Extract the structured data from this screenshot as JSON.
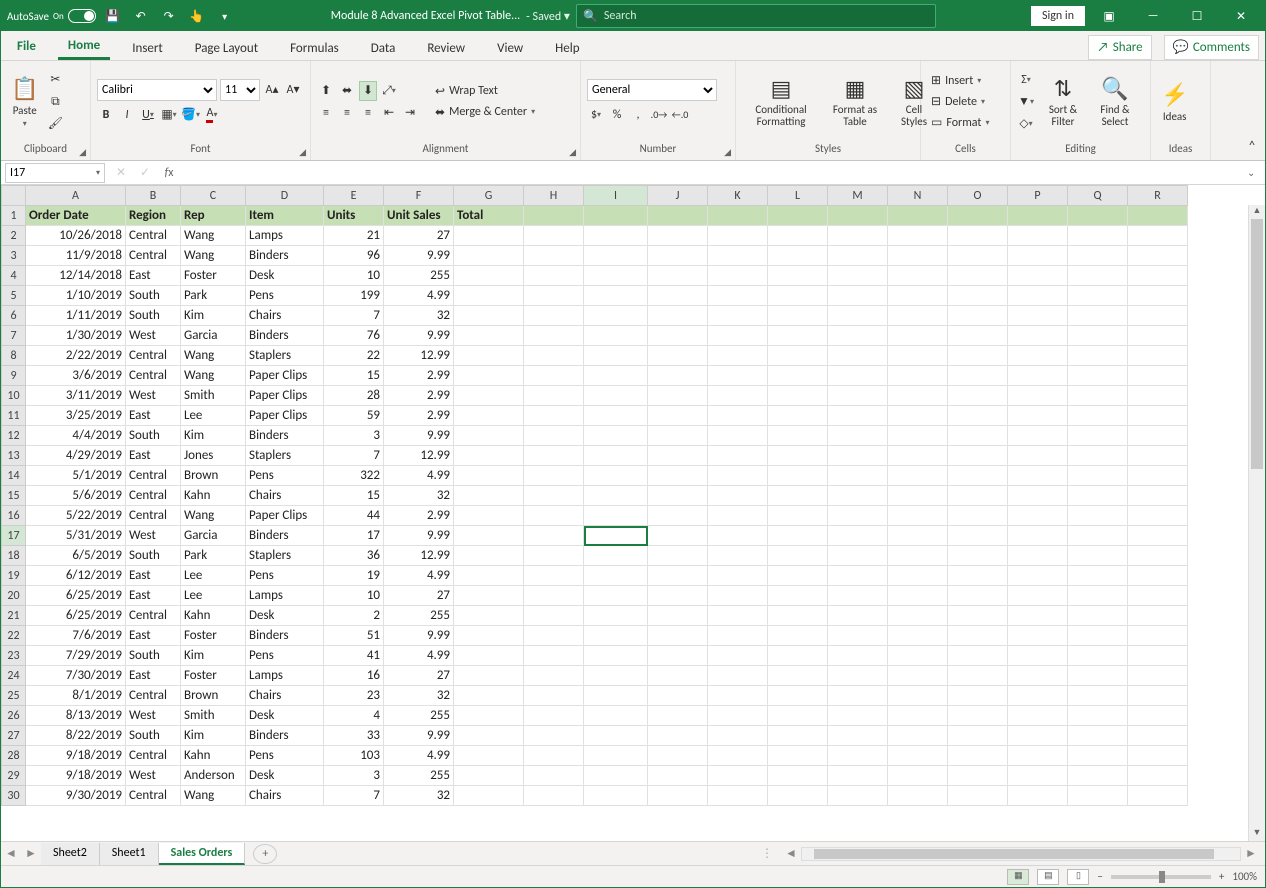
{
  "titlebar": {
    "autosave_label": "AutoSave",
    "autosave_state": "On",
    "document_name": "Module 8 Advanced Excel Pivot Table...",
    "save_status": "- Saved ▾",
    "search_placeholder": "Search",
    "signin_label": "Sign in"
  },
  "tabs": {
    "file": "File",
    "items": [
      "Home",
      "Insert",
      "Page Layout",
      "Formulas",
      "Data",
      "Review",
      "View",
      "Help"
    ],
    "active": "Home",
    "share": "Share",
    "comments": "Comments"
  },
  "ribbon": {
    "clipboard": {
      "label": "Clipboard",
      "paste": "Paste"
    },
    "font": {
      "label": "Font",
      "name": "Calibri",
      "size": "11",
      "bold": "B",
      "italic": "I",
      "underline": "U"
    },
    "alignment": {
      "label": "Alignment",
      "wrap": "Wrap Text",
      "merge": "Merge & Center"
    },
    "number": {
      "label": "Number",
      "format": "General"
    },
    "styles": {
      "label": "Styles",
      "cond": "Conditional Formatting",
      "table": "Format as Table",
      "cell": "Cell Styles"
    },
    "cells": {
      "label": "Cells",
      "insert": "Insert",
      "delete": "Delete",
      "format": "Format"
    },
    "editing": {
      "label": "Editing",
      "sort": "Sort & Filter",
      "find": "Find & Select"
    },
    "ideas": {
      "label": "Ideas",
      "btn": "Ideas"
    }
  },
  "formula_bar": {
    "namebox": "I17",
    "value": ""
  },
  "columns": [
    {
      "name": "rowhdr",
      "label": "",
      "w": 24
    },
    {
      "name": "A",
      "label": "A",
      "w": 100
    },
    {
      "name": "B",
      "label": "B",
      "w": 55
    },
    {
      "name": "C",
      "label": "C",
      "w": 65
    },
    {
      "name": "D",
      "label": "D",
      "w": 78
    },
    {
      "name": "E",
      "label": "E",
      "w": 60
    },
    {
      "name": "F",
      "label": "F",
      "w": 70
    },
    {
      "name": "G",
      "label": "G",
      "w": 70
    },
    {
      "name": "H",
      "label": "H",
      "w": 60
    },
    {
      "name": "I",
      "label": "I",
      "w": 64
    },
    {
      "name": "J",
      "label": "J",
      "w": 60
    },
    {
      "name": "K",
      "label": "K",
      "w": 60
    },
    {
      "name": "L",
      "label": "L",
      "w": 60
    },
    {
      "name": "M",
      "label": "M",
      "w": 60
    },
    {
      "name": "N",
      "label": "N",
      "w": 60
    },
    {
      "name": "O",
      "label": "O",
      "w": 60
    },
    {
      "name": "P",
      "label": "P",
      "w": 60
    },
    {
      "name": "Q",
      "label": "Q",
      "w": 60
    },
    {
      "name": "R",
      "label": "R",
      "w": 60
    }
  ],
  "active_cell": {
    "col": "I",
    "row": 17
  },
  "headers": [
    "Order Date",
    "Region",
    "Rep",
    "Item",
    "Units",
    "Unit Sales",
    "Total"
  ],
  "rows": [
    [
      "10/26/2018",
      "Central",
      "Wang",
      "Lamps",
      "21",
      "27",
      ""
    ],
    [
      "11/9/2018",
      "Central",
      "Wang",
      "Binders",
      "96",
      "9.99",
      ""
    ],
    [
      "12/14/2018",
      "East",
      "Foster",
      "Desk",
      "10",
      "255",
      ""
    ],
    [
      "1/10/2019",
      "South",
      "Park",
      "Pens",
      "199",
      "4.99",
      ""
    ],
    [
      "1/11/2019",
      "South",
      "Kim",
      "Chairs",
      "7",
      "32",
      ""
    ],
    [
      "1/30/2019",
      "West",
      "Garcia",
      "Binders",
      "76",
      "9.99",
      ""
    ],
    [
      "2/22/2019",
      "Central",
      "Wang",
      "Staplers",
      "22",
      "12.99",
      ""
    ],
    [
      "3/6/2019",
      "Central",
      "Wang",
      "Paper Clips",
      "15",
      "2.99",
      ""
    ],
    [
      "3/11/2019",
      "West",
      "Smith",
      "Paper Clips",
      "28",
      "2.99",
      ""
    ],
    [
      "3/25/2019",
      "East",
      "Lee",
      "Paper Clips",
      "59",
      "2.99",
      ""
    ],
    [
      "4/4/2019",
      "South",
      "Kim",
      "Binders",
      "3",
      "9.99",
      ""
    ],
    [
      "4/29/2019",
      "East",
      "Jones",
      "Staplers",
      "7",
      "12.99",
      ""
    ],
    [
      "5/1/2019",
      "Central",
      "Brown",
      "Pens",
      "322",
      "4.99",
      ""
    ],
    [
      "5/6/2019",
      "Central",
      "Kahn",
      "Chairs",
      "15",
      "32",
      ""
    ],
    [
      "5/22/2019",
      "Central",
      "Wang",
      "Paper Clips",
      "44",
      "2.99",
      ""
    ],
    [
      "5/31/2019",
      "West",
      "Garcia",
      "Binders",
      "17",
      "9.99",
      ""
    ],
    [
      "6/5/2019",
      "South",
      "Park",
      "Staplers",
      "36",
      "12.99",
      ""
    ],
    [
      "6/12/2019",
      "East",
      "Lee",
      "Pens",
      "19",
      "4.99",
      ""
    ],
    [
      "6/25/2019",
      "East",
      "Lee",
      "Lamps",
      "10",
      "27",
      ""
    ],
    [
      "6/25/2019",
      "Central",
      "Kahn",
      "Desk",
      "2",
      "255",
      ""
    ],
    [
      "7/6/2019",
      "East",
      "Foster",
      "Binders",
      "51",
      "9.99",
      ""
    ],
    [
      "7/29/2019",
      "South",
      "Kim",
      "Pens",
      "41",
      "4.99",
      ""
    ],
    [
      "7/30/2019",
      "East",
      "Foster",
      "Lamps",
      "16",
      "27",
      ""
    ],
    [
      "8/1/2019",
      "Central",
      "Brown",
      "Chairs",
      "23",
      "32",
      ""
    ],
    [
      "8/13/2019",
      "West",
      "Smith",
      "Desk",
      "4",
      "255",
      ""
    ],
    [
      "8/22/2019",
      "South",
      "Kim",
      "Binders",
      "33",
      "9.99",
      ""
    ],
    [
      "9/18/2019",
      "Central",
      "Kahn",
      "Pens",
      "103",
      "4.99",
      ""
    ],
    [
      "9/18/2019",
      "West",
      "Anderson",
      "Desk",
      "3",
      "255",
      ""
    ],
    [
      "9/30/2019",
      "Central",
      "Wang",
      "Chairs",
      "7",
      "32",
      ""
    ]
  ],
  "sheet_tabs": {
    "items": [
      "Sheet2",
      "Sheet1",
      "Sales Orders"
    ],
    "active": "Sales Orders"
  },
  "statusbar": {
    "zoom": "100%"
  }
}
